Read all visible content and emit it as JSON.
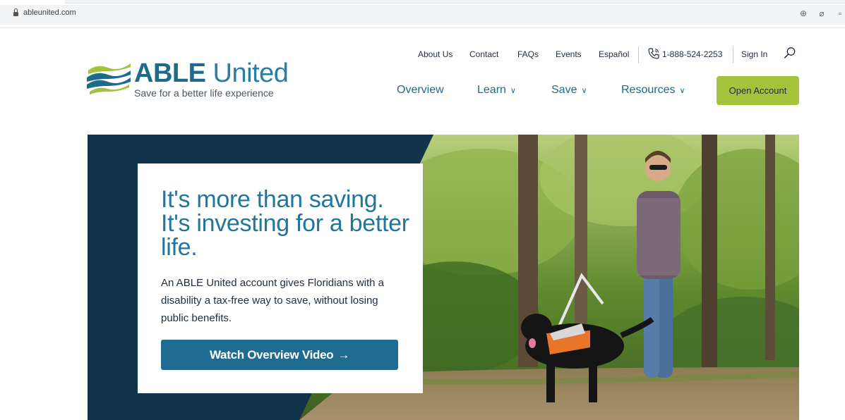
{
  "browser": {
    "url": "ableunited.com",
    "icons": [
      "zoom-icon",
      "eye-off-icon",
      "extension-icon"
    ]
  },
  "logo": {
    "brand_bold": "ABLE",
    "brand_light": "United",
    "tagline": "Save for a better life experience",
    "colors": {
      "blue": "#1d6a8a",
      "green": "#a3c33a"
    }
  },
  "utility_nav": {
    "items": [
      {
        "label": "About Us"
      },
      {
        "label": "Contact"
      },
      {
        "label": "FAQs"
      },
      {
        "label": "Events"
      },
      {
        "label": "Español"
      }
    ],
    "phone": "1-888-524-2253",
    "sign_in": "Sign In"
  },
  "main_nav": {
    "items": [
      {
        "label": "Overview"
      },
      {
        "label": "Learn"
      },
      {
        "label": "Save"
      },
      {
        "label": "Resources"
      }
    ],
    "cta": "Open Account"
  },
  "hero": {
    "title": "It's more than saving. It's investing for a better life.",
    "description": "An ABLE United account gives Floridians with a disability a tax-free way to save, without losing public benefits.",
    "button_label": "Watch Overview Video",
    "button_arrow": "→",
    "colors": {
      "panel_bg": "#ffffff",
      "navy": "#12344a",
      "button": "#1f6b92",
      "title": "#22769c"
    }
  }
}
